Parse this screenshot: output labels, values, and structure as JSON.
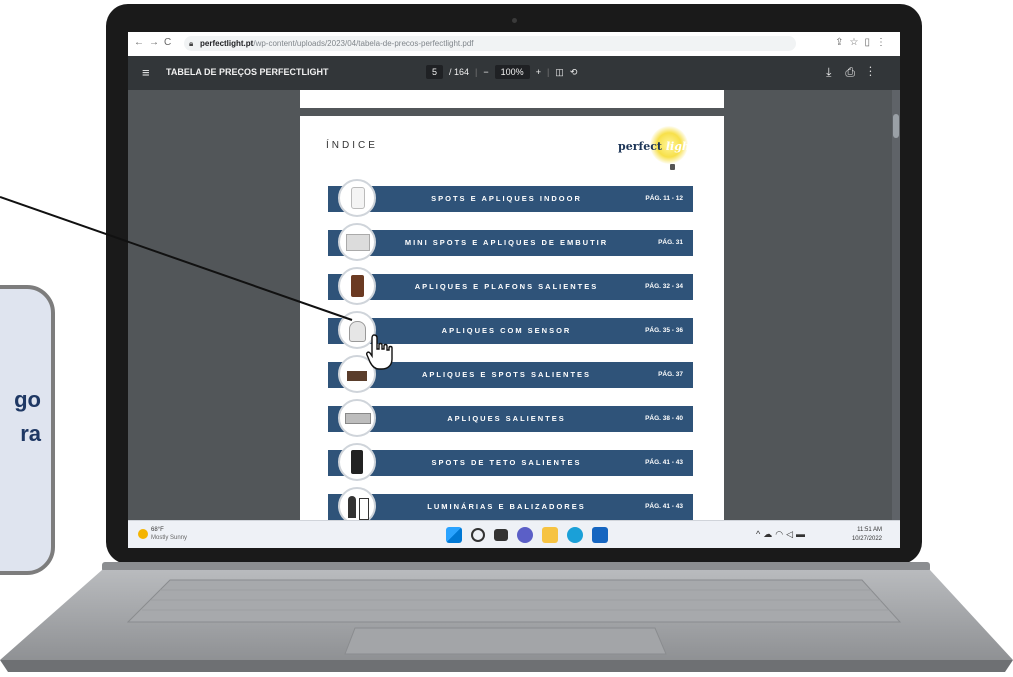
{
  "callout": {
    "line1": "go",
    "line2": "ra"
  },
  "browser": {
    "url_host": "perfectlight.pt",
    "url_path": "/wp-content/uploads/2023/04/tabela-de-precos-perfectlight.pdf"
  },
  "pdf_toolbar": {
    "title": "TABELA DE PREÇOS PERFECTLIGHT",
    "page_current": "5",
    "page_total": "/ 164",
    "zoom": "100%"
  },
  "page": {
    "heading": "ÍNDICE",
    "logo_word1": "perfect",
    "logo_word2": "light",
    "entries": [
      {
        "label": "SPOTS E APLIQUES INDOOR",
        "pages": "PÁG. 11 - 12"
      },
      {
        "label": "MINI SPOTS E APLIQUES DE EMBUTIR",
        "pages": "PÁG. 31"
      },
      {
        "label": "APLIQUES E PLAFONS SALIENTES",
        "pages": "PÁG. 32 - 34"
      },
      {
        "label": "APLIQUES COM SENSOR",
        "pages": "PÁG. 35 - 36"
      },
      {
        "label": "APLIQUES E SPOTS SALIENTES",
        "pages": "PÁG. 37"
      },
      {
        "label": "APLIQUES SALIENTES",
        "pages": "PÁG. 38 - 40"
      },
      {
        "label": "SPOTS DE TETO SALIENTES",
        "pages": "PÁG. 41 - 43"
      },
      {
        "label": "LUMINÁRIAS E BALIZADORES",
        "pages": "PÁG. 41 - 43"
      }
    ]
  },
  "taskbar": {
    "weather_temp": "68°F",
    "weather_desc": "Mostly Sunny",
    "time": "11:51 AM",
    "date": "10/27/2022"
  },
  "colors": {
    "row_blue": "#2f5379",
    "callout_bg": "#dfe4ef",
    "callout_text": "#1f3864"
  }
}
